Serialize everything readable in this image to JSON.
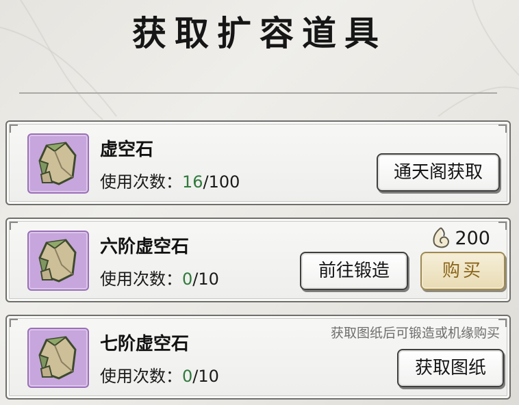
{
  "title": "获取扩容道具",
  "items": [
    {
      "name": "虚空石",
      "usage_label": "使用次数：",
      "usage_current": "16",
      "usage_max": "/100",
      "button": "通天阁获取"
    },
    {
      "name": "六阶虚空石",
      "usage_label": "使用次数：",
      "usage_current": "0",
      "usage_max": "/10",
      "price": "200",
      "forge_button": "前往锻造",
      "buy_button": "购买"
    },
    {
      "name": "七阶虚空石",
      "usage_label": "使用次数：",
      "usage_current": "0",
      "usage_max": "/10",
      "hint": "获取图纸后可锻造或机缘购买",
      "button": "获取图纸"
    }
  ],
  "icons": {
    "item": "void-stone-icon",
    "currency": "jade-currency-icon"
  },
  "colors": {
    "usage_current": "#2f7a3c",
    "item_frame": "#c6a6dc",
    "buy_text": "#8a6318"
  }
}
